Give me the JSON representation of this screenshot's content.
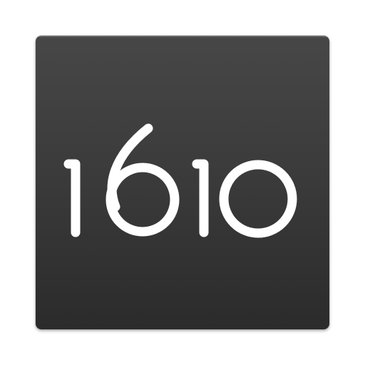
{
  "app_icon": {
    "logo_text": "1610",
    "background_color": "#3a3a3a",
    "logo_color": "#ffffff"
  }
}
